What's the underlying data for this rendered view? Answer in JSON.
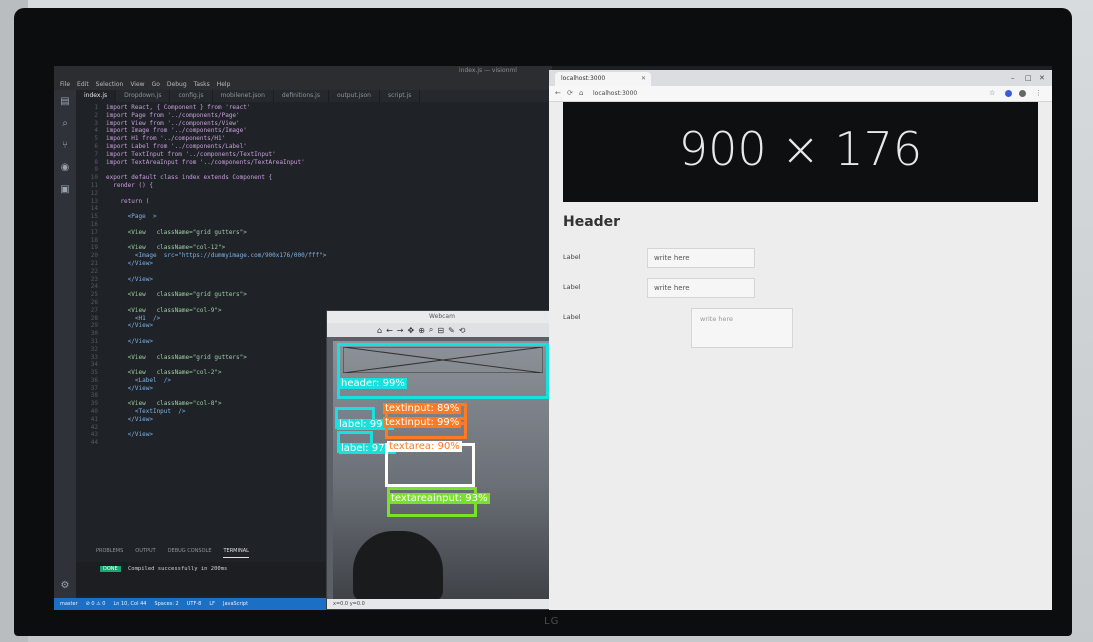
{
  "editor": {
    "title": "index.js — visionml",
    "menu": [
      "File",
      "Edit",
      "Selection",
      "View",
      "Go",
      "Debug",
      "Tasks",
      "Help"
    ],
    "tabs": [
      {
        "label": "index.js",
        "active": true
      },
      {
        "label": "Dropdown.js",
        "active": false
      },
      {
        "label": "config.js",
        "active": false
      },
      {
        "label": "mobilenet.json",
        "active": false
      },
      {
        "label": "definitions.js",
        "active": false
      },
      {
        "label": "output.json",
        "active": false
      },
      {
        "label": "script.js",
        "active": false
      }
    ],
    "code": [
      {
        "n": "1",
        "t": "import React, { Component } from 'react'"
      },
      {
        "n": "2",
        "t": "import Page from '../components/Page'"
      },
      {
        "n": "3",
        "t": "import View from '../components/View'"
      },
      {
        "n": "4",
        "t": "import Image from '../components/Image'"
      },
      {
        "n": "5",
        "t": "import H1 from '../components/H1'"
      },
      {
        "n": "6",
        "t": "import Label from '../components/Label'"
      },
      {
        "n": "7",
        "t": "import TextInput from '../components/TextInput'"
      },
      {
        "n": "8",
        "t": "import TextAreaInput from '../components/TextAreaInput'"
      },
      {
        "n": "9",
        "t": ""
      },
      {
        "n": "10",
        "t": "export default class index extends Component {"
      },
      {
        "n": "11",
        "t": "  render () {"
      },
      {
        "n": "12",
        "t": ""
      },
      {
        "n": "13",
        "t": "    return ("
      },
      {
        "n": "14",
        "t": ""
      },
      {
        "n": "15",
        "t": "      <Page  >"
      },
      {
        "n": "16",
        "t": ""
      },
      {
        "n": "17",
        "t": "      <View   className=\"grid gutters\">"
      },
      {
        "n": "18",
        "t": ""
      },
      {
        "n": "19",
        "t": "      <View   className=\"col-12\">"
      },
      {
        "n": "20",
        "t": "        <Image  src=\"https://dummyimage.com/900x176/000/fff\">"
      },
      {
        "n": "21",
        "t": "      </View>"
      },
      {
        "n": "22",
        "t": ""
      },
      {
        "n": "23",
        "t": "      </View>"
      },
      {
        "n": "24",
        "t": ""
      },
      {
        "n": "25",
        "t": "      <View   className=\"grid gutters\">"
      },
      {
        "n": "26",
        "t": ""
      },
      {
        "n": "27",
        "t": "      <View   className=\"col-9\">"
      },
      {
        "n": "28",
        "t": "        <H1  />"
      },
      {
        "n": "29",
        "t": "      </View>"
      },
      {
        "n": "30",
        "t": ""
      },
      {
        "n": "31",
        "t": "      </View>"
      },
      {
        "n": "32",
        "t": ""
      },
      {
        "n": "33",
        "t": "      <View   className=\"grid gutters\">"
      },
      {
        "n": "34",
        "t": ""
      },
      {
        "n": "35",
        "t": "      <View   className=\"col-2\">"
      },
      {
        "n": "36",
        "t": "        <Label  />"
      },
      {
        "n": "37",
        "t": "      </View>"
      },
      {
        "n": "38",
        "t": ""
      },
      {
        "n": "39",
        "t": "      <View   className=\"col-8\">"
      },
      {
        "n": "40",
        "t": "        <TextInput  />"
      },
      {
        "n": "41",
        "t": "      </View>"
      },
      {
        "n": "42",
        "t": ""
      },
      {
        "n": "43",
        "t": "      </View>"
      },
      {
        "n": "44",
        "t": ""
      }
    ],
    "panel_tabs": [
      "PROBLEMS",
      "OUTPUT",
      "DEBUG CONSOLE",
      "TERMINAL"
    ],
    "terminal": {
      "badge": "DONE",
      "text": "Compiled successfully in 200ms"
    },
    "status": [
      "master",
      "⊘ 0 ⚠ 0",
      "Ln 10, Col 44",
      "Spaces: 2",
      "UTF-8",
      "LF",
      "JavaScript"
    ]
  },
  "detector": {
    "title": "Webcam",
    "tools": [
      "⌂",
      "←",
      "→",
      "✥",
      "⊕",
      "⌕",
      "⊟",
      "✎",
      "⟲"
    ],
    "boxes": [
      {
        "name": "header-box",
        "label": "header: 99%",
        "color": "#19e0df"
      },
      {
        "name": "label-box-1",
        "label": "label: 99%",
        "color": "#19e0df"
      },
      {
        "name": "textinput-box-1",
        "label": "textinput: 89%",
        "color": "#ff7a22"
      },
      {
        "name": "textinput-box-2",
        "label": "textinput: 99%",
        "color": "#ff7a22"
      },
      {
        "name": "label-box-2",
        "label": "label: 97%",
        "color": "#19e0df"
      },
      {
        "name": "textarea-box",
        "label": "textarea: 90%",
        "color": "#ffffff"
      },
      {
        "name": "textareainput-box",
        "label": "textareainput: 93%",
        "color": "#7ae12a"
      }
    ],
    "status": "x=0.0 y=0.0"
  },
  "browser": {
    "tab_title": "localhost:3000",
    "url": "localhost:3000",
    "banner_text": "900 × 176",
    "header": "Header",
    "form": [
      {
        "label": "Label",
        "value": "write here"
      },
      {
        "label": "Label",
        "value": "write here"
      }
    ],
    "textarea": {
      "label": "Label",
      "placeholder": "write here"
    }
  },
  "brand": "LG"
}
